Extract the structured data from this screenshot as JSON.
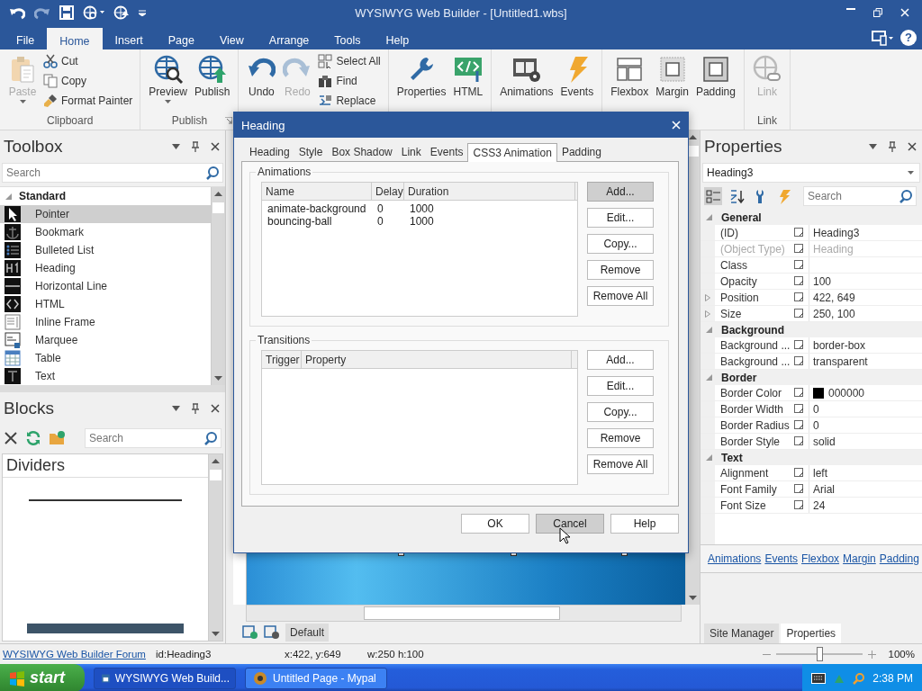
{
  "window": {
    "title": "WYSIWYG Web Builder - [Untitled1.wbs]",
    "help_button": "?"
  },
  "menu_tabs": [
    {
      "label": "File",
      "selected": false
    },
    {
      "label": "Home",
      "selected": true
    },
    {
      "label": "Insert",
      "selected": false
    },
    {
      "label": "Page",
      "selected": false
    },
    {
      "label": "View",
      "selected": false
    },
    {
      "label": "Arrange",
      "selected": false
    },
    {
      "label": "Tools",
      "selected": false
    },
    {
      "label": "Help",
      "selected": false
    }
  ],
  "ribbon": {
    "groups": [
      {
        "label": "Clipboard",
        "items": [
          {
            "label": "Paste",
            "kind": "large",
            "disabled": true,
            "dropdown": true
          },
          {
            "label": "Cut",
            "kind": "small",
            "disabled": false
          },
          {
            "label": "Copy",
            "kind": "small",
            "disabled": false
          },
          {
            "label": "Format Painter",
            "kind": "small",
            "disabled": false
          }
        ]
      },
      {
        "label": "Publish",
        "launcher": true,
        "items": [
          {
            "label": "Preview",
            "kind": "large",
            "disabled": false,
            "dropdown": true
          },
          {
            "label": "Publish",
            "kind": "large",
            "disabled": false
          }
        ]
      },
      {
        "items": [
          {
            "label": "Undo",
            "kind": "large",
            "disabled": false
          },
          {
            "label": "Redo",
            "kind": "large",
            "disabled": true
          },
          {
            "label": "Select All",
            "kind": "small",
            "disabled": false
          },
          {
            "label": "Find",
            "kind": "small",
            "disabled": false
          },
          {
            "label": "Replace",
            "kind": "small",
            "disabled": false
          }
        ]
      },
      {
        "items": [
          {
            "label": "Properties",
            "kind": "large",
            "disabled": false
          },
          {
            "label": "HTML",
            "kind": "large",
            "disabled": false
          }
        ]
      },
      {
        "items": [
          {
            "label": "Animations",
            "kind": "large",
            "disabled": false
          },
          {
            "label": "Events",
            "kind": "large",
            "disabled": false
          }
        ]
      },
      {
        "items": [
          {
            "label": "Flexbox",
            "kind": "large",
            "disabled": false
          },
          {
            "label": "Margin",
            "kind": "large",
            "disabled": false
          },
          {
            "label": "Padding",
            "kind": "large",
            "disabled": false
          }
        ]
      },
      {
        "label": "Link",
        "items": [
          {
            "label": "Link",
            "kind": "large",
            "disabled": true
          }
        ]
      }
    ]
  },
  "toolbox": {
    "title": "Toolbox",
    "search": {
      "placeholder": "Search"
    },
    "category": {
      "label": "Standard",
      "expanded": true
    },
    "items": [
      {
        "label": "Pointer",
        "selected": true
      },
      {
        "label": "Bookmark",
        "selected": false
      },
      {
        "label": "Bulleted List",
        "selected": false
      },
      {
        "label": "Heading",
        "selected": false
      },
      {
        "label": "Horizontal Line",
        "selected": false
      },
      {
        "label": "HTML",
        "selected": false
      },
      {
        "label": "Inline Frame",
        "selected": false
      },
      {
        "label": "Marquee",
        "selected": false
      },
      {
        "label": "Table",
        "selected": false
      },
      {
        "label": "Text",
        "selected": false
      }
    ]
  },
  "blocks": {
    "title": "Blocks",
    "search": {
      "placeholder": "Search"
    },
    "category": "Dividers"
  },
  "canvas": {
    "page_tabs": [
      {
        "label": "Default",
        "selected": true
      }
    ]
  },
  "dialog": {
    "title": "Heading",
    "tabs": [
      {
        "label": "Heading",
        "selected": false
      },
      {
        "label": "Style",
        "selected": false
      },
      {
        "label": "Box Shadow",
        "selected": false
      },
      {
        "label": "Link",
        "selected": false
      },
      {
        "label": "Events",
        "selected": false
      },
      {
        "label": "CSS3 Animation",
        "selected": true
      },
      {
        "label": "Padding",
        "selected": false
      }
    ],
    "animations": {
      "label": "Animations",
      "columns": [
        "Name",
        "Delay",
        "Duration"
      ],
      "rows": [
        [
          "animate-background",
          "0",
          "1000"
        ],
        [
          "bouncing-ball",
          "0",
          "1000"
        ]
      ],
      "buttons": [
        {
          "label": "Add...",
          "hovered": true
        },
        {
          "label": "Edit...",
          "hovered": false
        },
        {
          "label": "Copy...",
          "hovered": false
        },
        {
          "label": "Remove",
          "hovered": false
        },
        {
          "label": "Remove All",
          "hovered": false
        }
      ]
    },
    "transitions": {
      "label": "Transitions",
      "columns": [
        "Trigger",
        "Property"
      ],
      "buttons": [
        {
          "label": "Add...",
          "hovered": false
        },
        {
          "label": "Edit...",
          "hovered": false
        },
        {
          "label": "Copy...",
          "hovered": false
        },
        {
          "label": "Remove",
          "hovered": false
        },
        {
          "label": "Remove All",
          "hovered": false
        }
      ]
    },
    "footer": [
      {
        "label": "OK",
        "hovered": false
      },
      {
        "label": "Cancel",
        "hovered": true
      },
      {
        "label": "Help",
        "hovered": false
      }
    ]
  },
  "properties": {
    "title": "Properties",
    "object": "Heading3",
    "search": {
      "placeholder": "Search"
    },
    "view_buttons": [
      {
        "selected": true
      },
      {
        "selected": false
      },
      {
        "selected": false
      },
      {
        "selected": false
      }
    ],
    "groups": [
      {
        "label": "General",
        "expanded": true,
        "rows": [
          {
            "name": "(ID)",
            "value": "Heading3",
            "kind": "text",
            "disabled": false
          },
          {
            "name": "(Object Type)",
            "value": "Heading",
            "kind": "text",
            "disabled": true
          },
          {
            "name": "Class",
            "kind": "text",
            "disabled": false
          },
          {
            "name": "Opacity",
            "value": "100",
            "kind": "text",
            "disabled": false
          },
          {
            "name": "Position",
            "value": "422, 649",
            "kind": "expander",
            "disabled": false
          },
          {
            "name": "Size",
            "value": "250, 100",
            "kind": "expander",
            "disabled": false
          }
        ]
      },
      {
        "label": "Background",
        "expanded": true,
        "rows": [
          {
            "name": "Background ...",
            "value": "border-box",
            "kind": "text",
            "disabled": false
          },
          {
            "name": "Background ...",
            "value": "transparent",
            "kind": "text",
            "disabled": false
          }
        ]
      },
      {
        "label": "Border",
        "expanded": true,
        "rows": [
          {
            "name": "Border Color",
            "value": "000000",
            "kind": "color",
            "color": "#000000",
            "disabled": false
          },
          {
            "name": "Border Width",
            "value": "0",
            "kind": "text",
            "disabled": false
          },
          {
            "name": "Border Radius",
            "value": "0",
            "kind": "text",
            "disabled": false
          },
          {
            "name": "Border Style",
            "value": "solid",
            "kind": "text",
            "disabled": false
          }
        ]
      },
      {
        "label": "Text",
        "expanded": true,
        "rows": [
          {
            "name": "Alignment",
            "value": "left",
            "kind": "text",
            "disabled": false
          },
          {
            "name": "Font Family",
            "value": "Arial",
            "kind": "text",
            "disabled": false
          },
          {
            "name": "Font Size",
            "value": "24",
            "kind": "text",
            "disabled": false
          }
        ]
      }
    ],
    "links": [
      "Animations",
      "Events",
      "Flexbox",
      "Margin",
      "Padding"
    ],
    "tabs": [
      {
        "label": "Site Manager",
        "selected": false
      },
      {
        "label": "Properties",
        "selected": true
      }
    ]
  },
  "status_bar": {
    "link": "WYSIWYG Web Builder Forum",
    "id": "id:Heading3",
    "position": "x:422, y:649",
    "size": "w:250 h:100",
    "zoom": {
      "level": 0.5,
      "reading": "100%"
    }
  },
  "taskbar": {
    "start": "start",
    "tasks": [
      {
        "label": "WYSIWYG Web Build...",
        "selected": true
      },
      {
        "label": "Untitled Page - Mypal",
        "selected": false
      }
    ],
    "clock": "2:38 PM"
  }
}
